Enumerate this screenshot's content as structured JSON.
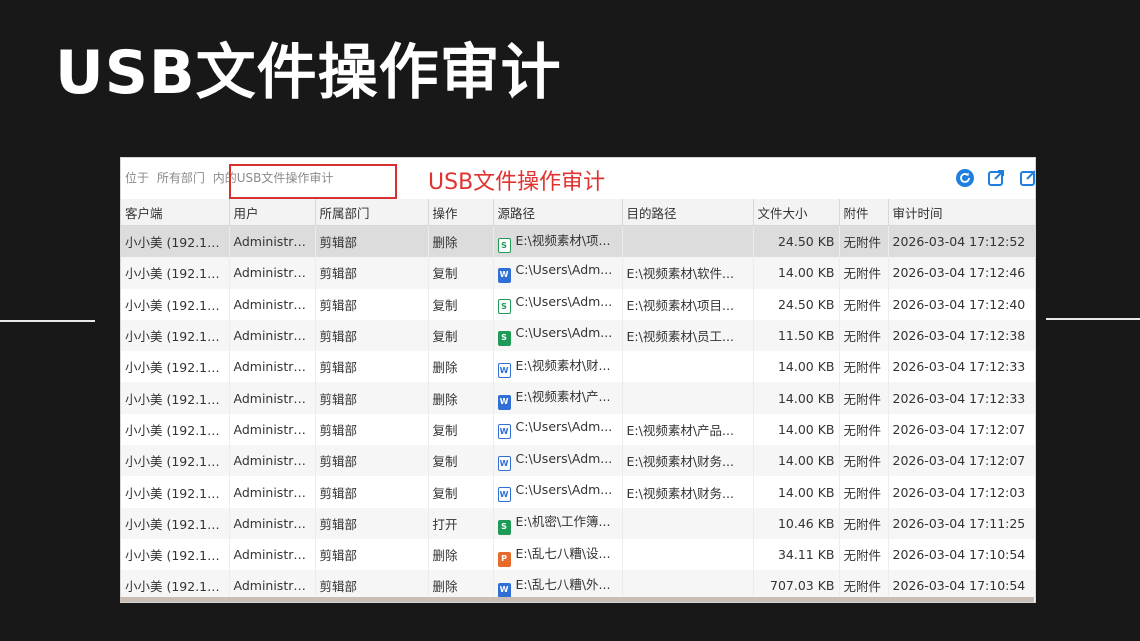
{
  "slide": {
    "title": "USB文件操作审计"
  },
  "toolbar": {
    "breadcrumb_prefix": "位于",
    "breadcrumb_scope": "所有部门",
    "breadcrumb_in": "内的",
    "breadcrumb_view": "USB文件操作审计",
    "annotation": "USB文件操作审计",
    "icons": [
      "refresh-icon",
      "export-icon",
      "export2-icon"
    ]
  },
  "table": {
    "columns": [
      "客户端",
      "用户",
      "所属部门",
      "操作",
      "源路径",
      "目的路径",
      "文件大小",
      "附件",
      "审计时间"
    ],
    "rows": [
      {
        "client": "小小美 (192.16...",
        "user": "Administra...",
        "dept": "剪辑部",
        "op": "删除",
        "icon": "xls-o",
        "src": "E:\\视频素材\\项...",
        "dst": "",
        "size": "24.50 KB",
        "attach": "无附件",
        "time": "2026-03-04 17:12:52"
      },
      {
        "client": "小小美 (192.16...",
        "user": "Administra...",
        "dept": "剪辑部",
        "op": "复制",
        "icon": "doc",
        "src": "C:\\Users\\Adm...",
        "dst": "E:\\视频素材\\软件...",
        "size": "14.00 KB",
        "attach": "无附件",
        "time": "2026-03-04 17:12:46"
      },
      {
        "client": "小小美 (192.16...",
        "user": "Administra...",
        "dept": "剪辑部",
        "op": "复制",
        "icon": "xls-o",
        "src": "C:\\Users\\Adm...",
        "dst": "E:\\视频素材\\项目...",
        "size": "24.50 KB",
        "attach": "无附件",
        "time": "2026-03-04 17:12:40"
      },
      {
        "client": "小小美 (192.16...",
        "user": "Administra...",
        "dept": "剪辑部",
        "op": "复制",
        "icon": "xls",
        "src": "C:\\Users\\Adm...",
        "dst": "E:\\视频素材\\员工...",
        "size": "11.50 KB",
        "attach": "无附件",
        "time": "2026-03-04 17:12:38"
      },
      {
        "client": "小小美 (192.16...",
        "user": "Administra...",
        "dept": "剪辑部",
        "op": "删除",
        "icon": "doc-o",
        "src": "E:\\视频素材\\财...",
        "dst": "",
        "size": "14.00 KB",
        "attach": "无附件",
        "time": "2026-03-04 17:12:33"
      },
      {
        "client": "小小美 (192.16...",
        "user": "Administra...",
        "dept": "剪辑部",
        "op": "删除",
        "icon": "doc",
        "src": "E:\\视频素材\\产...",
        "dst": "",
        "size": "14.00 KB",
        "attach": "无附件",
        "time": "2026-03-04 17:12:33"
      },
      {
        "client": "小小美 (192.16...",
        "user": "Administra...",
        "dept": "剪辑部",
        "op": "复制",
        "icon": "doc-o",
        "src": "C:\\Users\\Adm...",
        "dst": "E:\\视频素材\\产品...",
        "size": "14.00 KB",
        "attach": "无附件",
        "time": "2026-03-04 17:12:07"
      },
      {
        "client": "小小美 (192.16...",
        "user": "Administra...",
        "dept": "剪辑部",
        "op": "复制",
        "icon": "doc-o",
        "src": "C:\\Users\\Adm...",
        "dst": "E:\\视频素材\\财务...",
        "size": "14.00 KB",
        "attach": "无附件",
        "time": "2026-03-04 17:12:07"
      },
      {
        "client": "小小美 (192.16...",
        "user": "Administra...",
        "dept": "剪辑部",
        "op": "复制",
        "icon": "doc-o",
        "src": "C:\\Users\\Adm...",
        "dst": "E:\\视频素材\\财务...",
        "size": "14.00 KB",
        "attach": "无附件",
        "time": "2026-03-04 17:12:03"
      },
      {
        "client": "小小美 (192.16...",
        "user": "Administra...",
        "dept": "剪辑部",
        "op": "打开",
        "icon": "xls",
        "src": "E:\\机密\\工作簿...",
        "dst": "",
        "size": "10.46 KB",
        "attach": "无附件",
        "time": "2026-03-04 17:11:25"
      },
      {
        "client": "小小美 (192.16...",
        "user": "Administra...",
        "dept": "剪辑部",
        "op": "删除",
        "icon": "ppt",
        "src": "E:\\乱七八糟\\设...",
        "dst": "",
        "size": "34.11 KB",
        "attach": "无附件",
        "time": "2026-03-04 17:10:54"
      },
      {
        "client": "小小美 (192.16...",
        "user": "Administra...",
        "dept": "剪辑部",
        "op": "删除",
        "icon": "doc",
        "src": "E:\\乱七八糟\\外...",
        "dst": "",
        "size": "707.03 KB",
        "attach": "无附件",
        "time": "2026-03-04 17:10:54"
      }
    ]
  },
  "colors": {
    "accent": "#d9302f",
    "background": "#181818",
    "selected_row": "#dcdcdc"
  }
}
